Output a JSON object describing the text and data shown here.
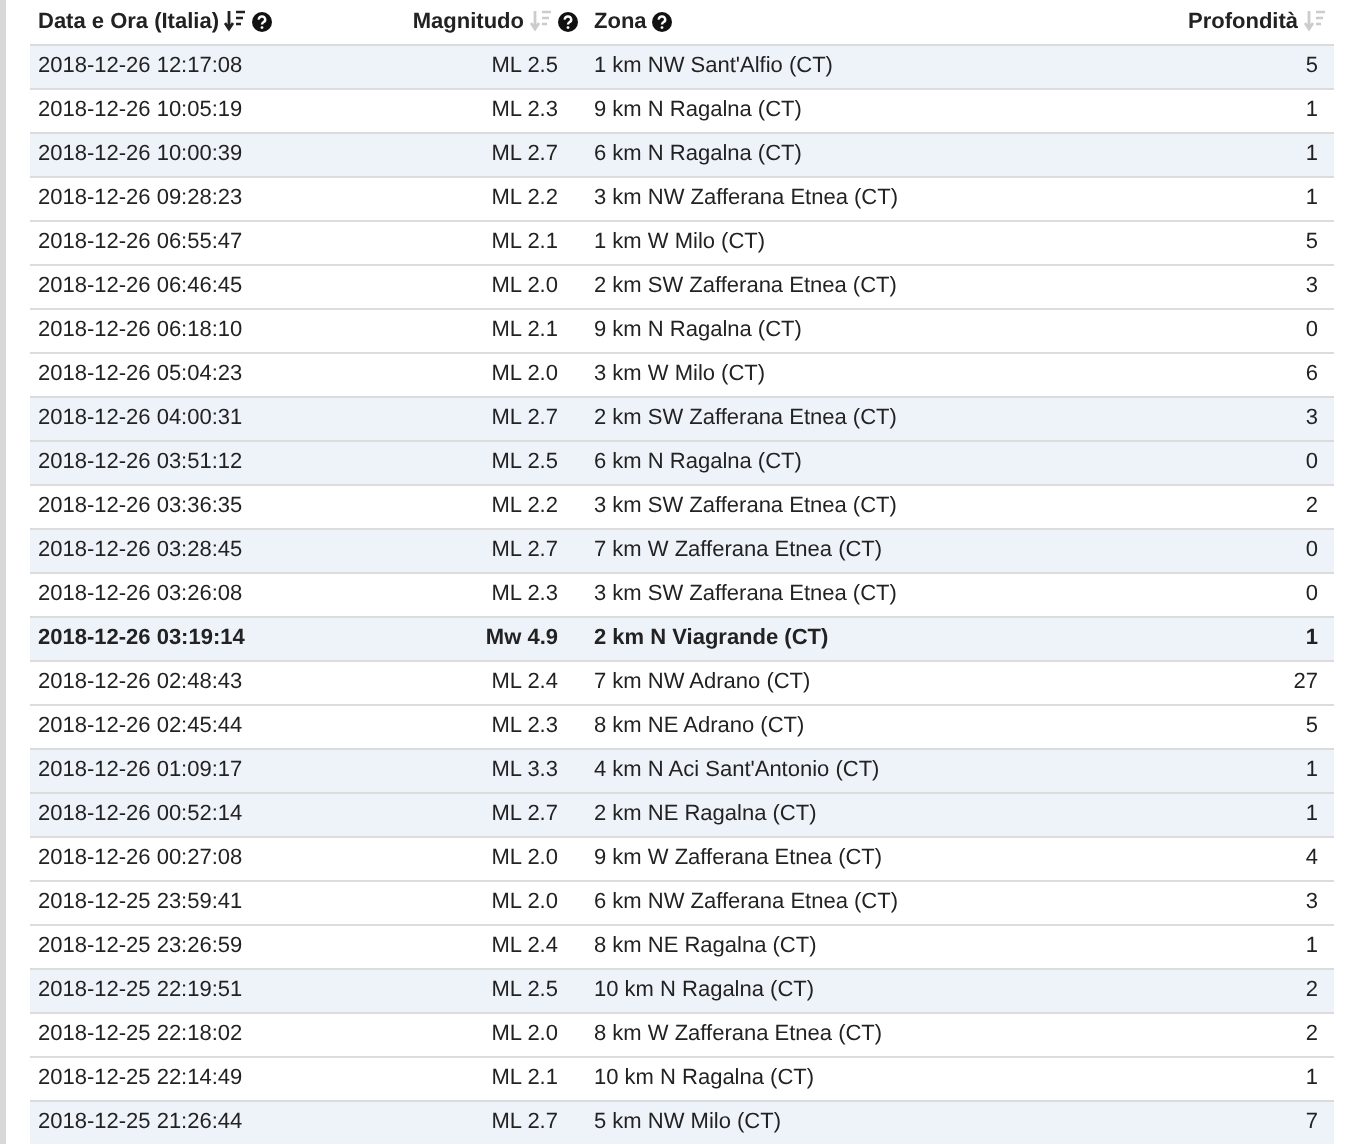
{
  "table": {
    "columns": [
      {
        "label": "Data e Ora (Italia)",
        "sortable": true,
        "sorted": true,
        "help": true
      },
      {
        "label": "Magnitudo",
        "sortable": true,
        "sorted": false,
        "help": true
      },
      {
        "label": "Zona",
        "sortable": false,
        "help": true
      },
      {
        "label": "Profondità",
        "sortable": true,
        "sorted": false,
        "help": false
      }
    ],
    "rows": [
      {
        "cells": [
          "2018-12-26 12:17:08",
          "ML 2.5",
          "1 km NW Sant'Alfio (CT)",
          "5"
        ],
        "shaded": true,
        "bold": false
      },
      {
        "cells": [
          "2018-12-26 10:05:19",
          "ML 2.3",
          "9 km N Ragalna (CT)",
          "1"
        ],
        "shaded": false,
        "bold": false
      },
      {
        "cells": [
          "2018-12-26 10:00:39",
          "ML 2.7",
          "6 km N Ragalna (CT)",
          "1"
        ],
        "shaded": true,
        "bold": false
      },
      {
        "cells": [
          "2018-12-26 09:28:23",
          "ML 2.2",
          "3 km NW Zafferana Etnea (CT)",
          "1"
        ],
        "shaded": false,
        "bold": false
      },
      {
        "cells": [
          "2018-12-26 06:55:47",
          "ML 2.1",
          "1 km W Milo (CT)",
          "5"
        ],
        "shaded": false,
        "bold": false
      },
      {
        "cells": [
          "2018-12-26 06:46:45",
          "ML 2.0",
          "2 km SW Zafferana Etnea (CT)",
          "3"
        ],
        "shaded": false,
        "bold": false
      },
      {
        "cells": [
          "2018-12-26 06:18:10",
          "ML 2.1",
          "9 km N Ragalna (CT)",
          "0"
        ],
        "shaded": false,
        "bold": false
      },
      {
        "cells": [
          "2018-12-26 05:04:23",
          "ML 2.0",
          "3 km W Milo (CT)",
          "6"
        ],
        "shaded": false,
        "bold": false
      },
      {
        "cells": [
          "2018-12-26 04:00:31",
          "ML 2.7",
          "2 km SW Zafferana Etnea (CT)",
          "3"
        ],
        "shaded": true,
        "bold": false
      },
      {
        "cells": [
          "2018-12-26 03:51:12",
          "ML 2.5",
          "6 km N Ragalna (CT)",
          "0"
        ],
        "shaded": true,
        "bold": false
      },
      {
        "cells": [
          "2018-12-26 03:36:35",
          "ML 2.2",
          "3 km SW Zafferana Etnea (CT)",
          "2"
        ],
        "shaded": false,
        "bold": false
      },
      {
        "cells": [
          "2018-12-26 03:28:45",
          "ML 2.7",
          "7 km W Zafferana Etnea (CT)",
          "0"
        ],
        "shaded": true,
        "bold": false
      },
      {
        "cells": [
          "2018-12-26 03:26:08",
          "ML 2.3",
          "3 km SW Zafferana Etnea (CT)",
          "0"
        ],
        "shaded": false,
        "bold": false
      },
      {
        "cells": [
          "2018-12-26 03:19:14",
          "Mw 4.9",
          "2 km N Viagrande (CT)",
          "1"
        ],
        "shaded": true,
        "bold": true
      },
      {
        "cells": [
          "2018-12-26 02:48:43",
          "ML 2.4",
          "7 km NW Adrano (CT)",
          "27"
        ],
        "shaded": false,
        "bold": false
      },
      {
        "cells": [
          "2018-12-26 02:45:44",
          "ML 2.3",
          "8 km NE Adrano (CT)",
          "5"
        ],
        "shaded": false,
        "bold": false
      },
      {
        "cells": [
          "2018-12-26 01:09:17",
          "ML 3.3",
          "4 km N Aci Sant'Antonio (CT)",
          "1"
        ],
        "shaded": true,
        "bold": false
      },
      {
        "cells": [
          "2018-12-26 00:52:14",
          "ML 2.7",
          "2 km NE Ragalna (CT)",
          "1"
        ],
        "shaded": true,
        "bold": false
      },
      {
        "cells": [
          "2018-12-26 00:27:08",
          "ML 2.0",
          "9 km W Zafferana Etnea (CT)",
          "4"
        ],
        "shaded": false,
        "bold": false
      },
      {
        "cells": [
          "2018-12-25 23:59:41",
          "ML 2.0",
          "6 km NW Zafferana Etnea (CT)",
          "3"
        ],
        "shaded": false,
        "bold": false
      },
      {
        "cells": [
          "2018-12-25 23:26:59",
          "ML 2.4",
          "8 km NE Ragalna (CT)",
          "1"
        ],
        "shaded": false,
        "bold": false
      },
      {
        "cells": [
          "2018-12-25 22:19:51",
          "ML 2.5",
          "10 km N Ragalna (CT)",
          "2"
        ],
        "shaded": true,
        "bold": false
      },
      {
        "cells": [
          "2018-12-25 22:18:02",
          "ML 2.0",
          "8 km W Zafferana Etnea (CT)",
          "2"
        ],
        "shaded": false,
        "bold": false
      },
      {
        "cells": [
          "2018-12-25 22:14:49",
          "ML 2.1",
          "10 km N Ragalna (CT)",
          "1"
        ],
        "shaded": false,
        "bold": false
      },
      {
        "cells": [
          "2018-12-25 21:26:44",
          "ML 2.7",
          "5 km NW Milo (CT)",
          "7"
        ],
        "shaded": true,
        "bold": false
      }
    ]
  }
}
